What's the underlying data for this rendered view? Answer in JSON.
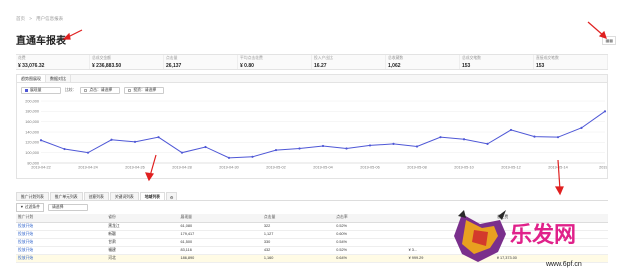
{
  "breadcrumb": [
    "首页",
    ">",
    "用户信息报表"
  ],
  "page_title": "直通车报表",
  "grid_toggle_label": "▦▦",
  "metrics": [
    {
      "label": "花费",
      "value": "¥ 33,076.32"
    },
    {
      "label": "总成交金额",
      "value": "¥ 236,883.50"
    },
    {
      "label": "点击量",
      "value": "26,137"
    },
    {
      "label": "平均点击花费",
      "value": "¥ 0.80"
    },
    {
      "label": "投入产出比",
      "value": "16.27"
    },
    {
      "label": "总收藏数",
      "value": "1,062"
    },
    {
      "label": "总成交笔数",
      "value": "153"
    },
    {
      "label": "直接成交笔数",
      "value": "153"
    }
  ],
  "chart_panel": {
    "tabs": [
      "趋势图展现",
      "数据对比"
    ],
    "metric_select": "展现量",
    "compare_label": "比较：",
    "compare_a": "点击：请选择",
    "compare_b": "投资：请选择"
  },
  "chart_data": {
    "type": "line",
    "x": [
      "2019-04-22",
      "2019-04-23",
      "2019-04-24",
      "2019-04-25",
      "2019-04-26",
      "2019-04-27",
      "2019-04-28",
      "2019-04-29",
      "2019-04-30",
      "2019-05-01",
      "2019-05-02",
      "2019-05-03",
      "2019-05-04",
      "2019-05-05",
      "2019-05-06",
      "2019-05-07",
      "2019-05-08",
      "2019-05-09",
      "2019-05-10",
      "2019-05-11",
      "2019-05-12",
      "2019-05-13",
      "2019-05-14",
      "2019-05-15",
      "2019-05-16"
    ],
    "x_tick_labels": [
      "2019-04-22",
      "2019-04-24",
      "2019-04-26",
      "2019-04-28",
      "2019-04-30",
      "2019-05-02",
      "2019-05-04",
      "2019-05-06",
      "2019-05-08",
      "2019-05-10",
      "2019-05-12",
      "2019-05-14",
      "2019-0"
    ],
    "series": [
      {
        "values": [
          124000,
          107000,
          100000,
          125000,
          121000,
          130000,
          100000,
          111000,
          90000,
          92000,
          105000,
          108000,
          113000,
          108000,
          114000,
          117000,
          112000,
          130000,
          126000,
          117000,
          144000,
          131000,
          130000,
          148000,
          180000
        ]
      }
    ],
    "y_ticks": [
      "200,000",
      "180,000",
      "160,000",
      "140,000",
      "120,000",
      "100,000",
      "80,000"
    ],
    "ylim": [
      80000,
      200000
    ],
    "grid": true,
    "color": "#4e57d6"
  },
  "lower_tabs": [
    "推广计划列表",
    "推广单元列表",
    "创意列表",
    "关键词列表",
    "地域列表",
    "⚙"
  ],
  "filter_button": "▼ 过滤条件",
  "filter_select": "请选择",
  "table": {
    "headers": [
      "推广计划",
      "省份",
      "展现量",
      "点击量",
      "点击率",
      "",
      "总花费"
    ],
    "rows": [
      [
        "投放开始",
        "黑龙江",
        "61,080",
        "322",
        "0.52%",
        "",
        ""
      ],
      [
        "投放开始",
        "新疆",
        "179,417",
        "1,127",
        "0.60%",
        "",
        ""
      ],
      [
        "投放开始",
        "甘肃",
        "61,500",
        "330",
        "0.54%",
        "",
        ""
      ],
      [
        "投放开始",
        "福建",
        "83,116",
        "432",
        "0.52%",
        "¥ 3...",
        ""
      ],
      [
        "投放开始",
        "河北",
        "186,890",
        "1,160",
        "0.64%",
        "¥ 999.29",
        "¥ 17,373.00"
      ]
    ]
  },
  "watermark": {
    "text": "乐发网",
    "url": "www.6pf.cn"
  }
}
